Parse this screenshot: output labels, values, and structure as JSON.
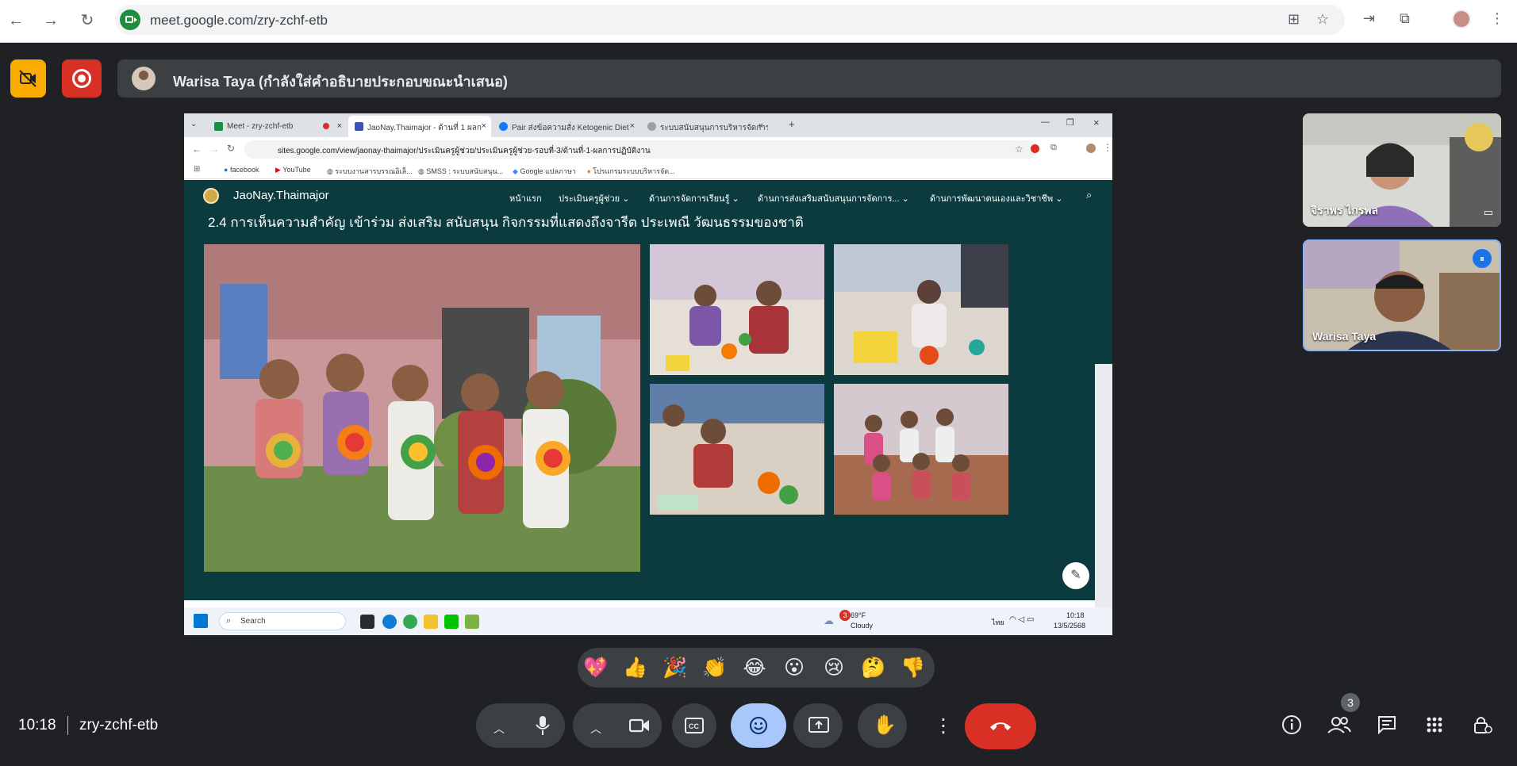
{
  "browser": {
    "url": "meet.google.com/zry-zchf-etb"
  },
  "meet": {
    "presenter_text": "Warisa Taya (กำลังใส่คำอธิบายประกอบขณะนำเสนอ)",
    "meeting_time": "10:18",
    "meeting_code": "zry-zchf-etb",
    "people_count": "3",
    "participants": [
      {
        "name": "จิราพร ไกรพล"
      },
      {
        "name": "Warisa Taya"
      }
    ],
    "reactions": [
      "💖",
      "👍",
      "🎉",
      "👏",
      "😂",
      "😮",
      "😢",
      "🤔",
      "👎"
    ]
  },
  "shared_screen": {
    "tabs": [
      {
        "label": "Meet - zry-zchf-etb"
      },
      {
        "label": "JaoNay.Thaimajor - ด้านที่ 1 ผลก"
      },
      {
        "label": "Pair ส่งข้อความสั่ง Ketogenic Diet"
      },
      {
        "label": "ระบบสนับสนุนการบริหารจัดการสถา"
      }
    ],
    "inner_url": "sites.google.com/view/jaonay-thaimajor/ประเมินครูผู้ช่วย/ประเมินครูผู้ช่วย-รอบที่-3/ด้านที่-1-ผลการปฏิบัติงาน",
    "bookmarks": [
      "facebook",
      "YouTube",
      "ระบบงานสารบรรณอิเล็...",
      "SMSS : ระบบสนับสนุน...",
      "Google แปลภาษา",
      "โปรแกรมระบบบริหารจัด..."
    ],
    "site_name": "JaoNay.Thaimajor",
    "site_nav": [
      "หน้าแรก",
      "ประเมินครูผู้ช่วย",
      "ด้านการจัดการเรียนรู้",
      "ด้านการส่งเสริมสนับสนุนการจัดการ...",
      "ด้านการพัฒนาตนเองและวิชาชีพ"
    ],
    "heading": "2.4 การเห็นความสำคัญ เข้าร่วม ส่งเสริม สนับสนุน กิจกรรมที่แสดงถึงจารีต ประเพณี วัฒนธรรมของชาติ",
    "taskbar": {
      "search": "Search",
      "weather_temp": "69°F",
      "weather_text": "Cloudy",
      "weather_badge": "3",
      "lang": "ไทย",
      "time": "10:18",
      "date": "13/5/2568"
    }
  },
  "colors": {
    "meet_bg": "#202124",
    "control_bg": "#3c4043",
    "leave_red": "#d93025",
    "cam_off_yellow": "#f9ab00",
    "emoji_active": "#a8c7fa",
    "site_bg": "#0b3b3e"
  },
  "icons": [
    "back-icon",
    "forward-icon",
    "reload-icon",
    "translate-icon",
    "star-icon",
    "extensions-icon",
    "mic-icon",
    "camera-icon",
    "captions-icon",
    "emoji-icon",
    "present-icon",
    "raise-hand-icon",
    "more-icon",
    "leave-call-icon",
    "info-icon",
    "people-icon",
    "chat-icon",
    "activities-icon",
    "host-controls-icon"
  ]
}
